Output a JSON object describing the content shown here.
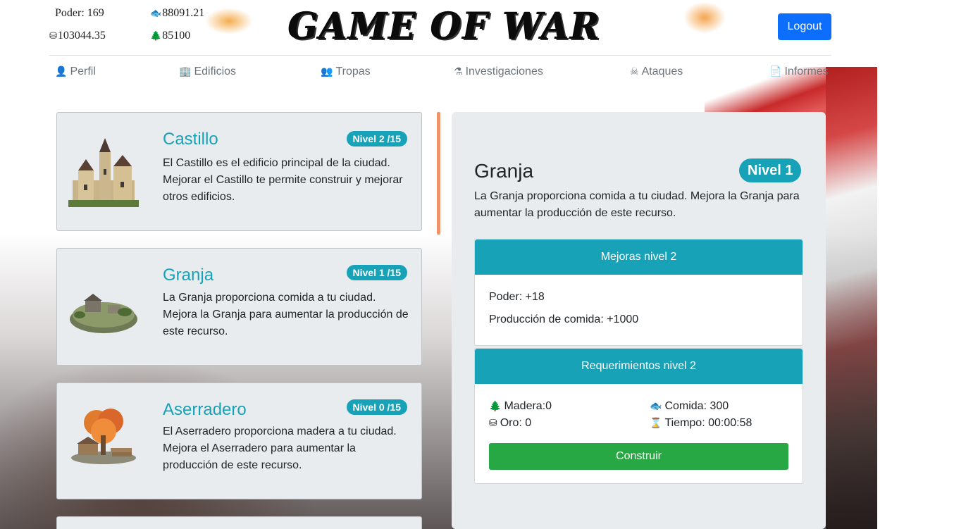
{
  "header": {
    "resources": {
      "poder": "Poder: 169",
      "comida": "88091.21",
      "oro": "103044.35",
      "madera": "85100"
    },
    "logo_text": "GAME OF WAR",
    "logout_label": "Logout"
  },
  "nav": {
    "items": [
      {
        "label": "Perfil",
        "icon": "user-icon"
      },
      {
        "label": "Edificios",
        "icon": "building-icon"
      },
      {
        "label": "Tropas",
        "icon": "troops-icon"
      },
      {
        "label": "Investigaciones",
        "icon": "flask-icon"
      },
      {
        "label": "Ataques",
        "icon": "attack-icon"
      },
      {
        "label": "Informes",
        "icon": "report-icon"
      }
    ]
  },
  "buildings": [
    {
      "name": "Castillo",
      "level": "Nivel 2 /15",
      "description": "El Castillo es el edificio principal de la ciudad. Mejorar el Castillo te permite construir y mejorar otros edificios."
    },
    {
      "name": "Granja",
      "level": "Nivel 1 /15",
      "description": "La Granja proporciona comida a tu ciudad. Mejora la Granja para aumentar la producción de este recurso."
    },
    {
      "name": "Aserradero",
      "level": "Nivel 0 /15",
      "description": "El Aserradero proporciona madera a tu ciudad. Mejora el Aserradero para aumentar la producción de este recurso."
    }
  ],
  "detail": {
    "title": "Granja",
    "level_badge": "Nivel 1",
    "description": "La Granja proporciona comida a tu ciudad. Mejora la Granja para aumentar la producción de este recurso.",
    "upgrades": {
      "header": "Mejoras nivel 2",
      "items": [
        "Poder: +18",
        "Producción de comida: +1000"
      ]
    },
    "requirements": {
      "header": "Requerimientos nivel 2",
      "madera": "Madera:0",
      "comida": "Comida: 300",
      "oro": "Oro: 0",
      "tiempo": "Tiempo: 00:00:58"
    },
    "build_label": "Construir"
  },
  "colors": {
    "accent": "#17a2b8",
    "logout": "#0d6efd",
    "build": "#28a745",
    "card_bg": "#e9ecef"
  }
}
